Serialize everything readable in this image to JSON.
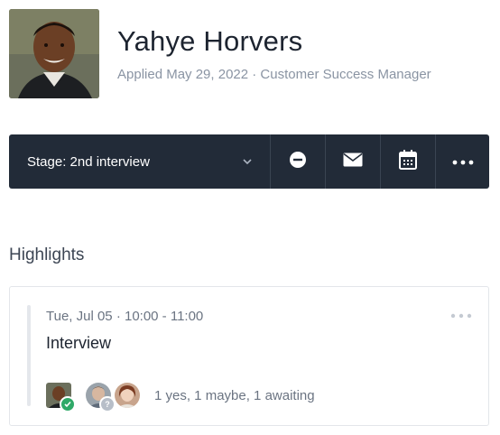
{
  "candidate": {
    "name": "Yahye Horvers",
    "subtitle": "Applied May 29, 2022 · Customer Success Manager"
  },
  "toolbar": {
    "stage_label": "Stage: 2nd interview",
    "actions": [
      "reject-icon",
      "email-icon",
      "calendar-icon",
      "more-icon"
    ]
  },
  "highlights": {
    "title": "Highlights",
    "cards": [
      {
        "time": "Tue, Jul 05 · 10:00 - 11:00",
        "title": "Interview",
        "vote_summary": "1 yes, 1 maybe, 1 awaiting"
      }
    ]
  },
  "colors": {
    "toolbar_bg": "#222b38",
    "yes_badge": "#2fa968",
    "maybe_badge": "#b7bec8"
  }
}
